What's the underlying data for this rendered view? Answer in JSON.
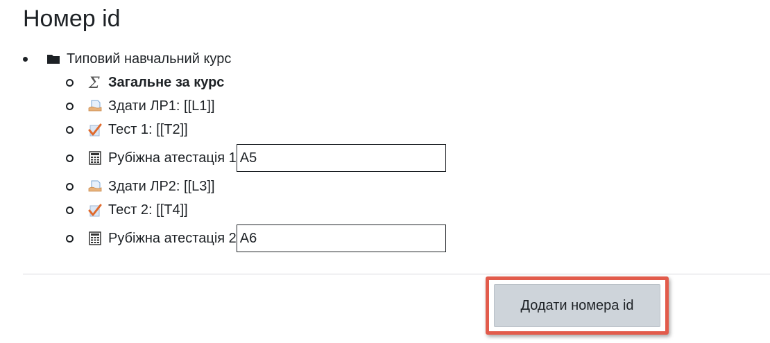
{
  "page": {
    "title": "Номер id"
  },
  "tree": {
    "category": {
      "label": "Типовий навчальний курс",
      "icon": "folder-icon"
    },
    "items": [
      {
        "label": "Загальне за курс",
        "icon": "sigma-icon",
        "bold": true
      },
      {
        "label": "Здати ЛР1: [[L1]]",
        "icon": "assignment-icon"
      },
      {
        "label": "Тест 1: [[T2]]",
        "icon": "quiz-icon"
      },
      {
        "label": "Рубіжна атестація 1",
        "icon": "calculator-icon",
        "idnumber_value": "A5"
      },
      {
        "label": "Здати ЛР2: [[L3]]",
        "icon": "assignment-icon"
      },
      {
        "label": "Тест 2: [[T4]]",
        "icon": "quiz-icon"
      },
      {
        "label": "Рубіжна атестація 2",
        "icon": "calculator-icon",
        "idnumber_value": "A6"
      }
    ]
  },
  "form": {
    "submit_label": "Додати номера id"
  },
  "colors": {
    "highlight_border": "#e25b4b",
    "button_bg": "#ced4da",
    "quiz_check": "#e06a2c",
    "assignment_hand": "#e8b27a",
    "assignment_paper": "#9fc5e8"
  }
}
